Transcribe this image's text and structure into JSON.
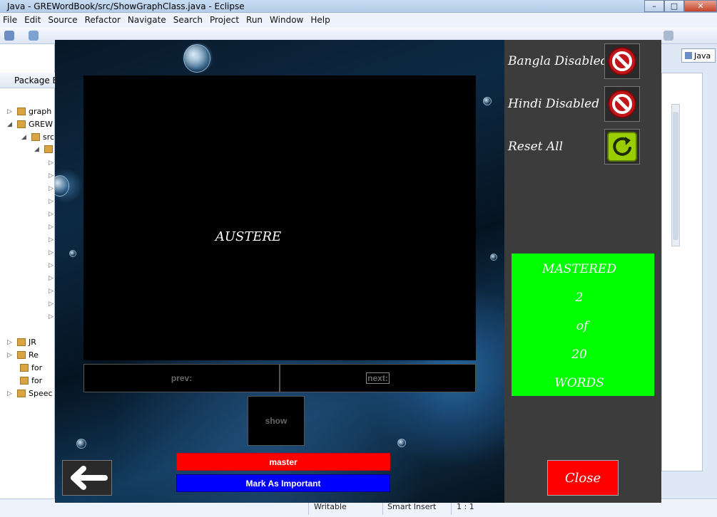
{
  "window": {
    "title": "Java - GREWordBook/src/ShowGraphClass.java - Eclipse",
    "min_label": "–",
    "max_label": "□",
    "close_label": "✕"
  },
  "menu": [
    "File",
    "Edit",
    "Source",
    "Refactor",
    "Navigate",
    "Search",
    "Project",
    "Run",
    "Window",
    "Help"
  ],
  "perspective": {
    "label": "Java"
  },
  "package_explorer": {
    "tab_label": "Package Ex",
    "items": [
      "graph",
      "GREW",
      "src",
      "JR",
      "Re",
      "for",
      "for",
      "Speec"
    ]
  },
  "statusbar": {
    "writable": "Writable",
    "insert_mode": "Smart Insert",
    "position": "1 : 1"
  },
  "flashcard": {
    "word": "AUSTERE",
    "prev_label": "prev:",
    "next_label": "next:",
    "show_label": "show",
    "master_label": "master",
    "important_label": "Mark As Important",
    "bangla_label": "Bangla Disabled",
    "hindi_label": "Hindi Disabled",
    "reset_label": "Reset All",
    "mastered": {
      "title": "MASTERED",
      "count": "2",
      "of_label": "of",
      "total": "20",
      "words_label": "WORDS"
    },
    "close_label": "Close",
    "icons": {
      "back": "arrow-left-icon",
      "bangla": "no-entry-icon",
      "hindi": "no-entry-icon",
      "reset": "refresh-icon"
    },
    "colors": {
      "master": "#ff0000",
      "important": "#0000ff",
      "mastered_box": "#00ff00",
      "close": "#ff0000"
    }
  }
}
